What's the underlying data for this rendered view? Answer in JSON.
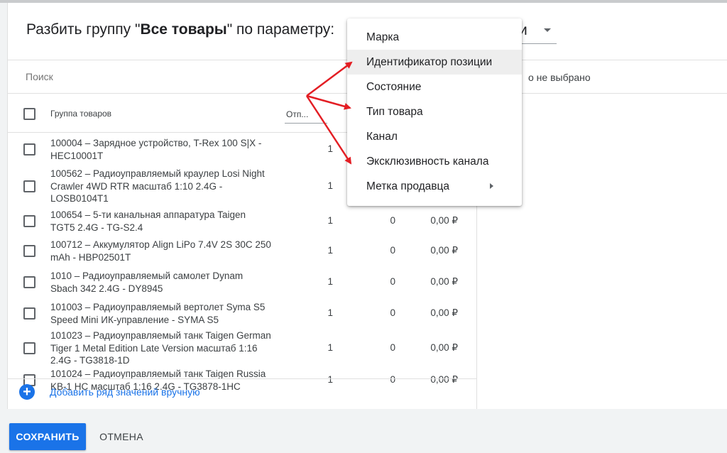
{
  "header": {
    "title_prefix": "Разбить группу \"",
    "group_name": "Все товары",
    "title_suffix": "\" по параметру:",
    "param_value": "и"
  },
  "search": {
    "placeholder": "Поиск"
  },
  "right_panel": {
    "note": "о не выбрано"
  },
  "table": {
    "col_group": "Группа товаров",
    "col_shipped": "Отп...",
    "rows": [
      {
        "name": "100004 – Зарядное устройство, T-Rex 100 S|X - HEC10001T",
        "qty": "1",
        "col2": "",
        "col3": ""
      },
      {
        "name": "100562 – Радиоуправляемый краулер Losi Night Crawler 4WD RTR масштаб 1:10 2.4G - LOSB0104T1",
        "qty": "1",
        "col2": "",
        "col3": ""
      },
      {
        "name": "100654 – 5-ти канальная аппаратура Taigen TGT5 2.4G - TG-S2.4",
        "qty": "1",
        "col2": "0",
        "col3": "0,00 ₽"
      },
      {
        "name": "100712 – Аккумулятор Align LiPo 7.4V 2S 30C 250 mAh - HBP02501T",
        "qty": "1",
        "col2": "0",
        "col3": "0,00 ₽"
      },
      {
        "name": "1010 – Радиоуправляемый самолет Dynam Sbach 342 2.4G - DY8945",
        "qty": "1",
        "col2": "0",
        "col3": "0,00 ₽"
      },
      {
        "name": "101003 – Радиоуправляемый вертолет Syma S5 Speed Mini ИК-управление - SYMA S5",
        "qty": "1",
        "col2": "0",
        "col3": "0,00 ₽"
      },
      {
        "name": "101023 – Радиоуправляемый танк Taigen German Tiger 1 Metal Edition Late Version масштаб 1:16 2.4G - TG3818-1D",
        "qty": "1",
        "col2": "0",
        "col3": "0,00 ₽"
      },
      {
        "name": "101024 – Радиоуправляемый танк Taigen Russia KB-1 HC масштаб 1:16 2.4G - TG3878-1HC",
        "qty": "1",
        "col2": "0",
        "col3": "0,00 ₽"
      }
    ]
  },
  "add_row": {
    "label": "Добавить ряд значений вручную"
  },
  "buttons": {
    "save": "СОХРАНИТЬ",
    "cancel": "ОТМЕНА"
  },
  "menu": {
    "items": [
      "Марка",
      "Идентификатор позиции",
      "Состояние",
      "Тип товара",
      "Канал",
      "Эксклюзивность канала",
      "Метка продавца"
    ]
  },
  "colors": {
    "accent": "#1a73e8",
    "arrow": "#e31e24"
  }
}
